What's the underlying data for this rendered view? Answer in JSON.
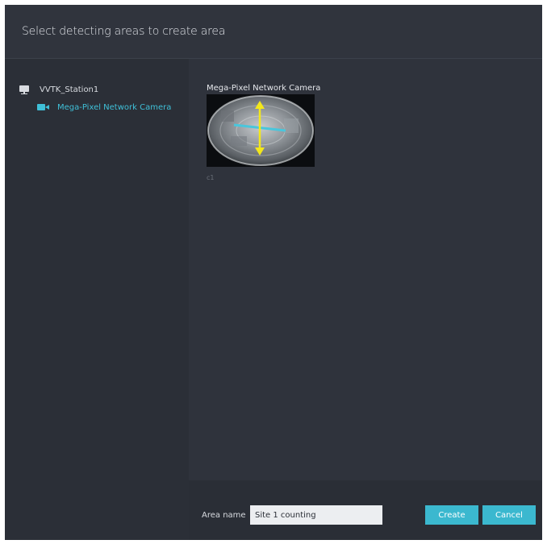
{
  "dialog": {
    "title": "Select detecting areas to create area"
  },
  "tree": {
    "station": {
      "label": "VVTK_Station1",
      "icon": "monitor-icon"
    },
    "camera": {
      "label": "Mega-Pixel Network Camera",
      "icon": "camera-icon",
      "color": "#3fc0d8"
    }
  },
  "preview": {
    "camera_title": "Mega-Pixel Network Camera",
    "thumbnail_label": "c1"
  },
  "footer": {
    "area_name_label": "Area name",
    "area_name_value": "Site 1 counting",
    "create_label": "Create",
    "cancel_label": "Cancel"
  },
  "colors": {
    "accent": "#3bb8cf",
    "background": "#2c3039"
  }
}
